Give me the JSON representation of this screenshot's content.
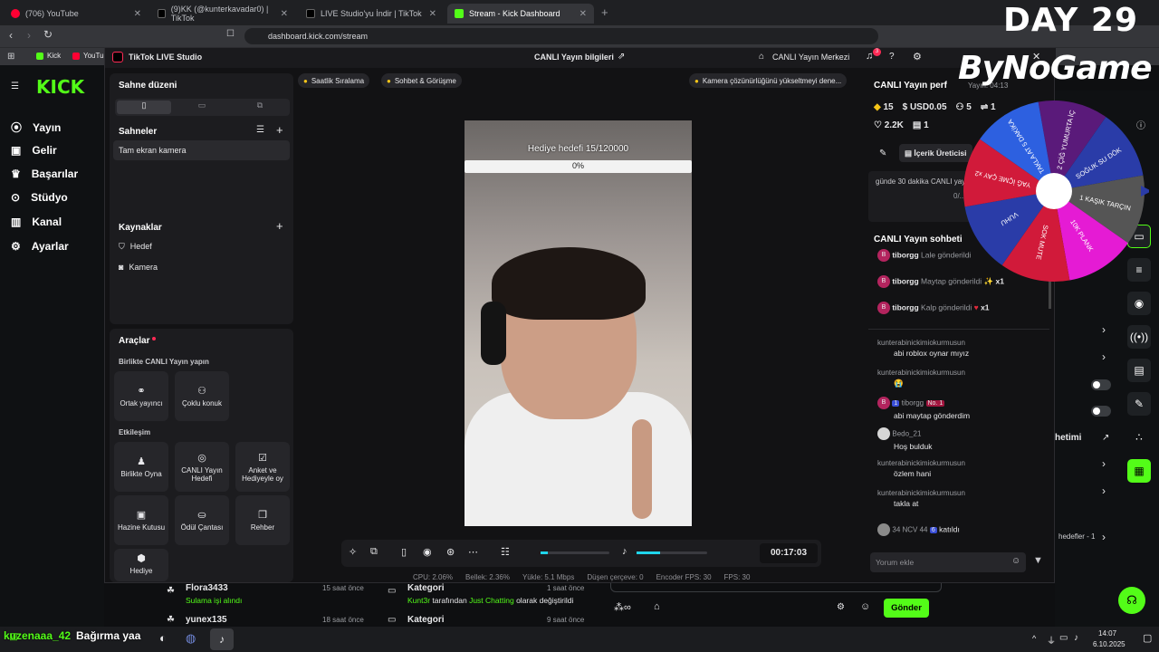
{
  "browser": {
    "tabs": [
      {
        "title": "(706) YouTube",
        "color": "#ff0033"
      },
      {
        "title": "(9)KK (@kunterkavadar0) | TikTok",
        "color": "#111111"
      },
      {
        "title": "LIVE Studio'yu İndir | TikTok",
        "color": "#111111"
      },
      {
        "title": "Stream - Kick Dashboard",
        "color": "#53fc18"
      }
    ],
    "url": "dashboard.kick.com/stream",
    "bookmarks": [
      "Kick",
      "YouTu"
    ]
  },
  "overlay": {
    "day": "DAY 29",
    "brand": "ByNoGame"
  },
  "kick": {
    "logo": "KICK",
    "nav": [
      "Yayın",
      "Gelir",
      "Başarılar",
      "Stüdyo",
      "Kanal",
      "Ayarlar"
    ],
    "right_label": "hetimi",
    "right_hedefler": "hedefler - 1",
    "send_label": "Gönder",
    "activity": [
      {
        "user": "Flora3433",
        "action": "Sulama işi alındı",
        "time": "15 saat önce"
      },
      {
        "user": "yunex135",
        "action": "",
        "time": "18 saat önce"
      }
    ],
    "category": [
      {
        "title": "Kategori",
        "user": "Kunt3r",
        "text": "tarafından",
        "cat": "Just Chatting",
        "suffix": "olarak değiştirildi",
        "time": "1 saat önce"
      },
      {
        "title": "Kategori",
        "time": "9 saat önce"
      }
    ]
  },
  "studio": {
    "title": "TikTok LIVE Studio",
    "center_title": "CANLI Yayın bilgileri",
    "center_btn": "CANLI Yayın Merkezi",
    "notif_count": "3",
    "scene_layout": "Sahne düzeni",
    "scenes_title": "Sahneler",
    "scene_item": "Tam ekran kamera",
    "sources_title": "Kaynaklar",
    "sources": [
      "Hedef",
      "Kamera"
    ],
    "tools_title": "Araçlar",
    "together_title": "Birlikte CANLI Yayın yapın",
    "together_tools": [
      "Ortak yayıncı",
      "Çoklu konuk"
    ],
    "engage_title": "Etkileşim",
    "engage_tools": [
      "Birlikte Oyna",
      "CANLI Yayın Hedefi",
      "Anket ve Hediyeyle oy",
      "Hazine Kutusu",
      "Ödül Çantası",
      "Rehber",
      "Hediye"
    ],
    "chips": [
      "Saatlik Sıralama",
      "Sohbet & Görüşme"
    ],
    "tip": "Kamera çözünürlüğünü yükseltmeyi dene...",
    "goal_label": "Hediye hedefi 15/120000",
    "goal_pct": "0%",
    "goal_progress": 0,
    "timer": "00:17:03",
    "stats": [
      "CPU: 2.06%",
      "Bellek: 2.36%",
      "Yükle: 5.1 Mbps",
      "Düşen çerçeve: 0",
      "Encoder FPS: 30",
      "FPS: 30"
    ]
  },
  "rightpanel": {
    "perf_title": "CANLI Yayın perf",
    "perf_time": "Yayın: 04:13",
    "diamonds": "15",
    "usd": "USD0.05",
    "viewers": "5",
    "shares": "1",
    "likes": "2.2K",
    "gifts": "1",
    "creator_btn": "İçerik Üreticisi",
    "task_text": "günde 30 dakika CANLI yayınBu hafta 2 gün b",
    "task_progress": "0/...",
    "chat_title": "CANLI Yayın sohbeti",
    "gifts_list": [
      {
        "user": "tiborgg",
        "text": "Lale gönderildi",
        "count": "x1"
      },
      {
        "user": "tiborgg",
        "text": "Maytap gönderildi",
        "count": "x1"
      },
      {
        "user": "tiborgg",
        "text": "Kalp gönderildi",
        "count": "x1"
      }
    ],
    "messages": [
      {
        "user": "kunterabinickimiokurmusun",
        "text": "abi roblox oynar mıyız"
      },
      {
        "user": "kunterabinickimiokurmusun",
        "text": "😭"
      },
      {
        "user": "tiborgg",
        "badge": "1",
        "rank": "No. 1",
        "text": "abi maytap gönderdim"
      },
      {
        "user": "Bedo_21",
        "text": "Hoş bulduk"
      },
      {
        "user": "kunterabinickimiokurmusun",
        "text": "özlem hani"
      },
      {
        "user": "kunterabinickimiokurmusun",
        "text": "takla at"
      },
      {
        "user": "34 NCV 44",
        "badge": "6",
        "text": "katıldı"
      }
    ],
    "comment_placeholder": "Yorum ekle"
  },
  "wheel": {
    "segments": [
      {
        "label": "2 ÇİĞ YUMURTA İÇ",
        "color": "#5a1a7a"
      },
      {
        "label": "SOĞUK SU DÖK",
        "color": "#2a3ca8"
      },
      {
        "label": "1 KAŞIK TARÇIN",
        "color": "#555555"
      },
      {
        "label": "10K PLANK",
        "color": "#e51bd4"
      },
      {
        "label": "SOK MUTE",
        "color": "#d11a3a"
      },
      {
        "label": "VUHU",
        "color": "#2a3ca8"
      },
      {
        "label": "YAĞ İÇME ÇAY x2",
        "color": "#d11a3a"
      },
      {
        "label": "TAKLA AT 5 DAKİKA",
        "color": "#2d60e0"
      }
    ]
  },
  "taskbar": {
    "ticker_user": "kuzenaaa_42",
    "ticker_text": "Bağırma yaa",
    "time": "14:07",
    "date": "6.10.2025"
  }
}
